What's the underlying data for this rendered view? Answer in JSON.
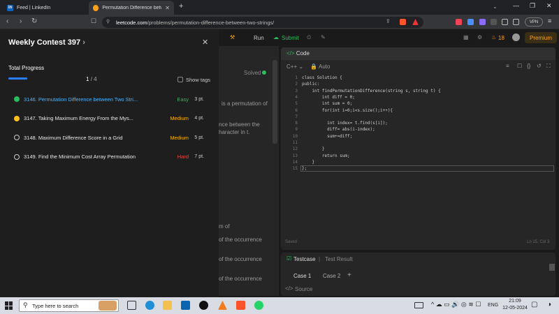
{
  "browser": {
    "tabs": [
      {
        "label": "Feed | LinkedIn",
        "icon": "linkedin-icon",
        "fav": "in"
      },
      {
        "label": "Permutation Difference betweer",
        "icon": "leetcode-icon"
      }
    ],
    "url_domain": "leetcode.com",
    "url_path": "/problems/permutation-difference-between-two-strings/"
  },
  "leetcode": {
    "run_label": "Run",
    "submit_label": "Submit",
    "streak": "18",
    "premium_label": "Premium",
    "solved_label": "Solved",
    "desc_snippets": [
      "is a permutation of",
      "nce between the",
      "haracter in t.",
      "m of",
      "of the occurrence",
      "of the occurrence",
      "of the occurrence"
    ],
    "code_title": "Code",
    "language": "C++",
    "auto_label": "Auto",
    "code_lines": [
      "class Solution {",
      "public:",
      "    int findPermutationDifference(string s, string t) {",
      "        int diff = 0;",
      "        int sum = 0;",
      "        for(int i=0;i<s.size();i++){",
      "",
      "          int index= t.find(s[i]);",
      "          diff= abs(i-index);",
      "          sum+=diff;",
      "",
      "        }",
      "        return sum;",
      "    }",
      "};"
    ],
    "saved_label": "Saved",
    "cursor_pos": "Ln 15, Col 3",
    "testcase_tab": "Testcase",
    "result_tab": "Test Result",
    "cases": [
      "Case 1",
      "Case 2"
    ],
    "add_case": "+",
    "source_label": "Source"
  },
  "sidebar": {
    "title": "Weekly Contest 397",
    "progress_label": "Total Progress",
    "progress_text": "1",
    "progress_total": "/ 4",
    "progress_fraction": 0.25,
    "show_tags_label": "Show tags",
    "problems": [
      {
        "name": "3146. Permutation Difference between Two Stri...",
        "difficulty": "Easy",
        "points": "3 pt.",
        "status": "solved",
        "color": "#4db6ff",
        "diff_color": "#2cbb5d"
      },
      {
        "name": "3147. Taking Maximum Energy From the Mys...",
        "difficulty": "Medium",
        "points": "4 pt.",
        "status": "attempted",
        "color": "#e8e8e8",
        "diff_color": "#ffb800"
      },
      {
        "name": "3148. Maximum Difference Score in a Grid",
        "difficulty": "Medium",
        "points": "5 pt.",
        "status": "none",
        "color": "#e8e8e8",
        "diff_color": "#ffb800"
      },
      {
        "name": "3149. Find the Minimum Cost Array Permutation",
        "difficulty": "Hard",
        "points": "7 pt.",
        "status": "none",
        "color": "#e8e8e8",
        "diff_color": "#ef4743"
      }
    ]
  },
  "taskbar": {
    "search_placeholder": "Type here to search",
    "lang": "ENG",
    "time": "21:09",
    "date": "12-05-2024"
  }
}
